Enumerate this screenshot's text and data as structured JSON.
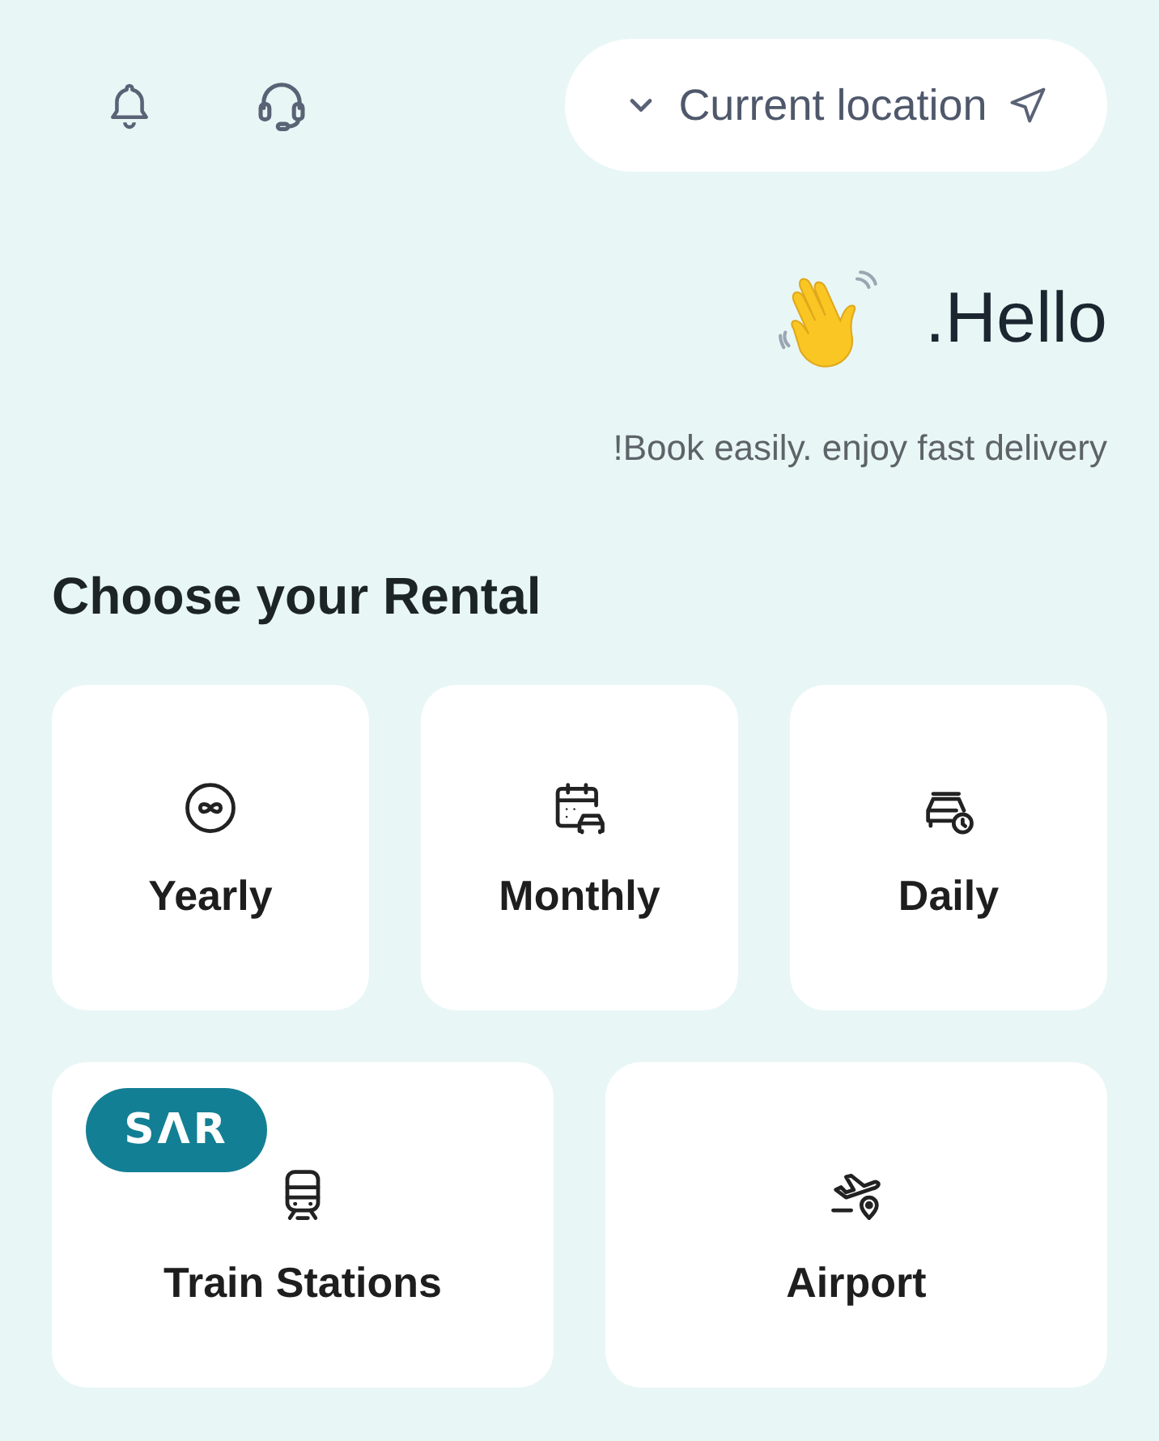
{
  "header": {
    "location_label": "Current location"
  },
  "greeting": {
    "title": ".Hello",
    "subtitle": "!Book easily. enjoy fast delivery"
  },
  "section": {
    "title": "Choose your Rental"
  },
  "rental_rows": [
    {
      "options": [
        {
          "kind": "yearly",
          "label": "Yearly"
        },
        {
          "kind": "monthly",
          "label": "Monthly"
        },
        {
          "kind": "daily",
          "label": "Daily"
        }
      ]
    },
    {
      "options": [
        {
          "kind": "train",
          "label": "Train Stations",
          "badge": "SΛR"
        },
        {
          "kind": "airport",
          "label": "Airport"
        }
      ]
    }
  ]
}
